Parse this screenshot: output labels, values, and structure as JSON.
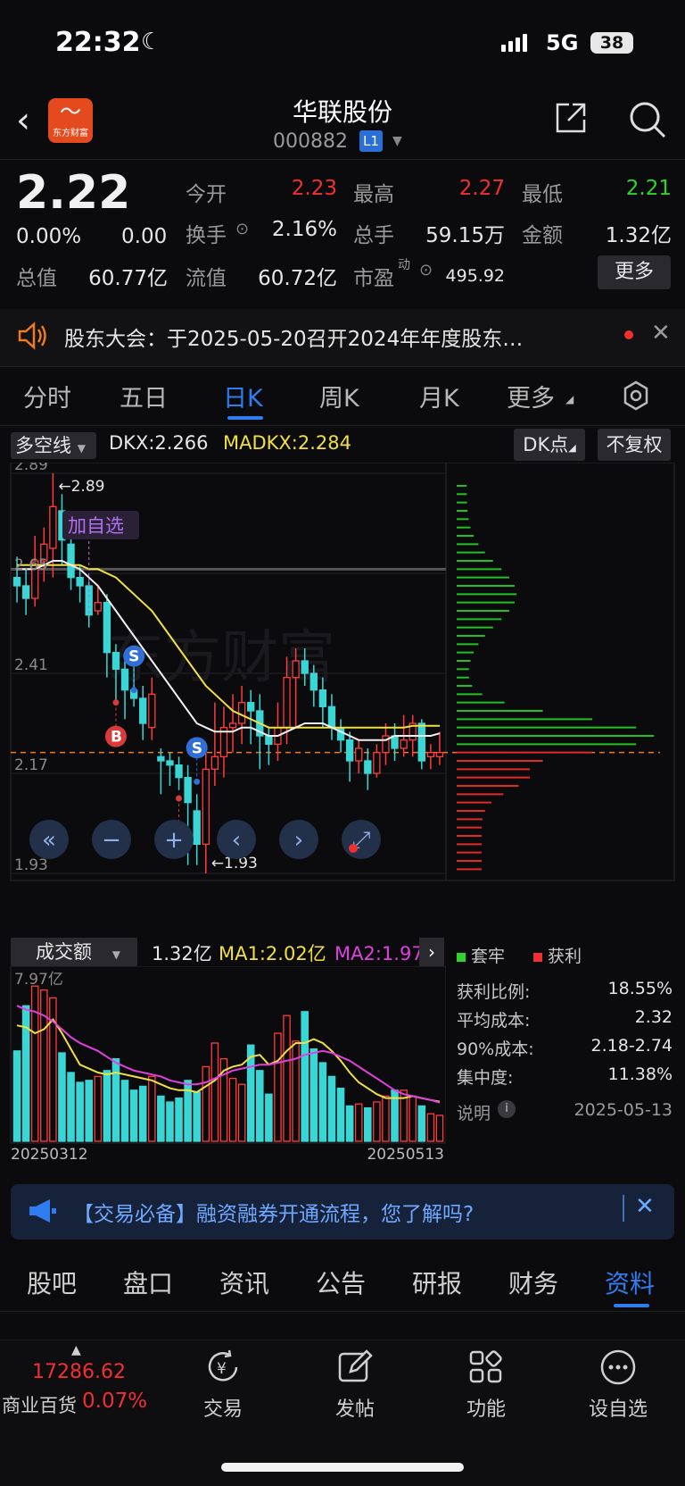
{
  "status_bar": {
    "time": "22:32",
    "network": "5G",
    "battery": "38"
  },
  "header": {
    "title": "华联股份",
    "code": "000882",
    "level": "L1",
    "logo_text": "东方财富"
  },
  "quote": {
    "price": "2.22",
    "change_pct": "0.00%",
    "change": "0.00",
    "fields": [
      {
        "label": "今开",
        "value": "2.23",
        "color": "red"
      },
      {
        "label": "最高",
        "value": "2.27",
        "color": "red"
      },
      {
        "label": "最低",
        "value": "2.21",
        "color": "green"
      },
      {
        "label": "换手",
        "value": "2.16%",
        "color": "white"
      },
      {
        "label": "总手",
        "value": "59.15万",
        "color": "white"
      },
      {
        "label": "金额",
        "value": "1.32亿",
        "color": "white"
      },
      {
        "label": "总值",
        "value": "60.77亿",
        "color": "white"
      },
      {
        "label": "流值",
        "value": "60.72亿",
        "color": "white"
      },
      {
        "label": "市盈",
        "value": "495.92",
        "color": "white",
        "sup": "动"
      }
    ],
    "more_label": "更多"
  },
  "notice": {
    "text": "股东大会：于2025-05-20召开2024年年度股东…"
  },
  "chart_tabs": [
    "分时",
    "五日",
    "日K",
    "周K",
    "月K",
    "更多"
  ],
  "active_tab": "日K",
  "indicator": {
    "selector": "多空线",
    "dkx_label": "DKX:2.266",
    "madkx_label": "MADKX:2.284",
    "dk_button": "DK点",
    "fq_button": "不复权"
  },
  "chart_data": {
    "type": "candlestick",
    "y_axis_labels": [
      "2.89",
      "2.65",
      "2.41",
      "2.17",
      "1.93"
    ],
    "ylim": [
      1.93,
      2.89
    ],
    "high_marker": "←2.89",
    "low_marker": "←1.93",
    "annotation": "加自选",
    "signals": [
      "S",
      "S",
      "B",
      "B"
    ],
    "x_labels": [
      "20250312",
      "20250513"
    ],
    "volume_max_label": "7.97亿",
    "candles": [
      [
        2.64,
        2.62,
        2.69,
        2.58
      ],
      [
        2.62,
        2.59,
        2.66,
        2.55
      ],
      [
        2.59,
        2.68,
        2.74,
        2.57
      ],
      [
        2.68,
        2.72,
        2.76,
        2.63
      ],
      [
        2.71,
        2.81,
        2.89,
        2.64
      ],
      [
        2.8,
        2.73,
        2.84,
        2.67
      ],
      [
        2.72,
        2.64,
        2.74,
        2.61
      ],
      [
        2.64,
        2.62,
        2.67,
        2.58
      ],
      [
        2.62,
        2.55,
        2.63,
        2.52
      ],
      [
        2.56,
        2.58,
        2.62,
        2.55
      ],
      [
        2.58,
        2.46,
        2.6,
        2.4
      ],
      [
        2.46,
        2.42,
        2.48,
        2.34
      ],
      [
        2.42,
        2.37,
        2.45,
        2.3
      ],
      [
        2.37,
        2.35,
        2.44,
        2.33
      ],
      [
        2.35,
        2.29,
        2.38,
        2.25
      ],
      [
        2.28,
        2.36,
        2.4,
        2.25
      ],
      [
        2.21,
        2.2,
        2.23,
        2.12
      ],
      [
        2.2,
        2.19,
        2.22,
        2.14
      ],
      [
        2.19,
        2.16,
        2.21,
        2.13
      ],
      [
        2.16,
        2.1,
        2.19,
        1.95
      ],
      [
        2.08,
        2.0,
        2.12,
        1.95
      ],
      [
        2.0,
        2.18,
        2.22,
        1.93
      ],
      [
        2.18,
        2.21,
        2.34,
        2.14
      ],
      [
        2.21,
        2.28,
        2.33,
        2.16
      ],
      [
        2.28,
        2.29,
        2.36,
        2.22
      ],
      [
        2.29,
        2.34,
        2.38,
        2.24
      ],
      [
        2.34,
        2.32,
        2.37,
        2.24
      ],
      [
        2.32,
        2.26,
        2.36,
        2.18
      ],
      [
        2.26,
        2.24,
        2.28,
        2.19
      ],
      [
        2.24,
        2.28,
        2.34,
        2.2
      ],
      [
        2.28,
        2.4,
        2.45,
        2.24
      ],
      [
        2.4,
        2.44,
        2.47,
        2.28
      ],
      [
        2.44,
        2.41,
        2.47,
        2.38
      ],
      [
        2.41,
        2.37,
        2.43,
        2.33
      ],
      [
        2.37,
        2.33,
        2.4,
        2.28
      ],
      [
        2.33,
        2.28,
        2.36,
        2.25
      ],
      [
        2.28,
        2.25,
        2.3,
        2.22
      ],
      [
        2.25,
        2.2,
        2.27,
        2.15
      ],
      [
        2.2,
        2.23,
        2.25,
        2.17
      ],
      [
        2.2,
        2.17,
        2.23,
        2.13
      ],
      [
        2.17,
        2.22,
        2.24,
        2.16
      ],
      [
        2.22,
        2.26,
        2.29,
        2.19
      ],
      [
        2.26,
        2.23,
        2.29,
        2.2
      ],
      [
        2.23,
        2.25,
        2.31,
        2.21
      ],
      [
        2.25,
        2.29,
        2.31,
        2.21
      ],
      [
        2.29,
        2.2,
        2.3,
        2.18
      ],
      [
        2.21,
        2.22,
        2.24,
        2.18
      ],
      [
        2.21,
        2.22,
        2.27,
        2.19
      ]
    ],
    "dkx": [
      2.66,
      2.66,
      2.66,
      2.67,
      2.68,
      2.68,
      2.67,
      2.66,
      2.64,
      2.62,
      2.59,
      2.56,
      2.53,
      2.5,
      2.47,
      2.44,
      2.41,
      2.38,
      2.35,
      2.32,
      2.29,
      2.28,
      2.27,
      2.27,
      2.27,
      2.28,
      2.28,
      2.27,
      2.26,
      2.26,
      2.27,
      2.28,
      2.29,
      2.29,
      2.29,
      2.28,
      2.27,
      2.26,
      2.25,
      2.25,
      2.25,
      2.25,
      2.26,
      2.26,
      2.26,
      2.26,
      2.26,
      2.266
    ],
    "madkx": [
      2.67,
      2.67,
      2.67,
      2.67,
      2.67,
      2.67,
      2.67,
      2.67,
      2.66,
      2.66,
      2.65,
      2.64,
      2.62,
      2.6,
      2.58,
      2.56,
      2.53,
      2.5,
      2.47,
      2.44,
      2.41,
      2.38,
      2.36,
      2.34,
      2.32,
      2.31,
      2.3,
      2.29,
      2.28,
      2.28,
      2.28,
      2.28,
      2.28,
      2.28,
      2.28,
      2.28,
      2.28,
      2.28,
      2.28,
      2.28,
      2.28,
      2.28,
      2.28,
      2.28,
      2.284,
      2.284,
      2.284,
      2.284
    ],
    "volumes": [
      4.6,
      6.9,
      7.9,
      7.7,
      7.3,
      4.5,
      3.5,
      3.0,
      3.1,
      3.3,
      3.6,
      4.2,
      3.1,
      2.6,
      2.8,
      3.3,
      2.3,
      2.0,
      2.2,
      3.1,
      2.5,
      3.8,
      5.0,
      4.2,
      3.2,
      2.9,
      4.9,
      3.6,
      2.4,
      5.5,
      6.4,
      5.1,
      6.6,
      4.7,
      4.0,
      3.3,
      2.7,
      1.8,
      1.9,
      1.7,
      2.0,
      2.3,
      2.6,
      2.6,
      2.3,
      1.8,
      1.4,
      1.32
    ],
    "ma1": [
      5.9,
      5.8,
      5.5,
      5.7,
      6.2,
      5.5,
      4.7,
      3.9,
      3.7,
      3.5,
      3.4,
      3.5,
      3.4,
      3.3,
      3.2,
      3.1,
      2.9,
      2.7,
      2.6,
      2.6,
      2.5,
      2.8,
      3.1,
      3.6,
      3.8,
      3.9,
      4.3,
      4.4,
      3.9,
      4.1,
      4.6,
      5.0,
      5.0,
      5.2,
      5.0,
      4.6,
      4.1,
      3.5,
      3.0,
      2.7,
      2.4,
      2.2,
      2.2,
      2.2,
      2.3,
      2.2,
      2.1,
      2.02
    ],
    "ma2": [
      6.9,
      6.7,
      6.6,
      6.4,
      6.1,
      5.7,
      5.3,
      5.0,
      4.8,
      4.6,
      4.3,
      4.0,
      3.8,
      3.6,
      3.5,
      3.4,
      3.3,
      3.1,
      3.0,
      2.9,
      2.9,
      3.0,
      3.2,
      3.4,
      3.6,
      3.7,
      3.8,
      3.9,
      3.9,
      4.0,
      4.1,
      4.2,
      4.4,
      4.5,
      4.6,
      4.5,
      4.3,
      4.1,
      3.8,
      3.5,
      3.2,
      2.9,
      2.6,
      2.4,
      2.3,
      2.2,
      2.1,
      1.97
    ],
    "volume_legend": {
      "selector": "成交额",
      "value": "1.32亿",
      "ma1": "MA1:2.02亿",
      "ma2": "MA2:1.97亿"
    }
  },
  "chip_stats": {
    "legend": [
      "套牢",
      "获利"
    ],
    "rows": [
      {
        "label": "获利比例:",
        "value": "18.55%"
      },
      {
        "label": "平均成本:",
        "value": "2.32"
      },
      {
        "label": "90%成本:",
        "value": "2.18-2.74"
      },
      {
        "label": "集中度:",
        "value": "11.38%"
      }
    ],
    "note_label": "说明",
    "date": "2025-05-13"
  },
  "banner": {
    "text": "【交易必备】融资融券开通流程，您了解吗?"
  },
  "bottom_tabs": [
    "股吧",
    "盘口",
    "资讯",
    "公告",
    "研报",
    "财务",
    "资料"
  ],
  "active_bottom_tab": "资料",
  "toolbar": {
    "index_value": "17286.62",
    "index_name": "商业百货",
    "index_pct": "0.07%",
    "items": [
      "交易",
      "发帖",
      "功能",
      "设自选"
    ]
  }
}
